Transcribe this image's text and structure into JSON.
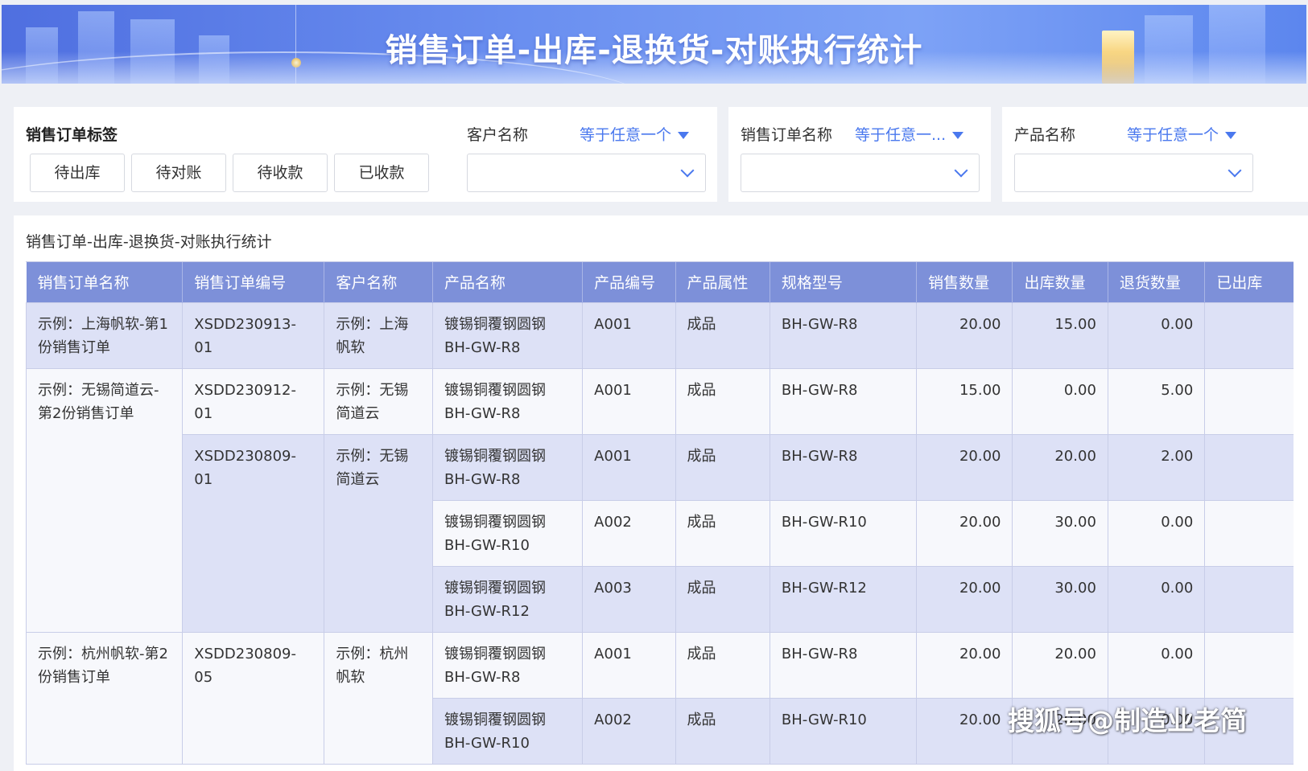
{
  "banner": {
    "title": "销售订单-出库-退换货-对账执行统计"
  },
  "tags": {
    "label": "销售订单标签",
    "buttons": [
      "待出库",
      "待对账",
      "待收款",
      "已收款"
    ]
  },
  "filters": [
    {
      "label": "客户名称",
      "operator": "等于任意一个"
    },
    {
      "label": "销售订单名称",
      "operator": "等于任意一..."
    },
    {
      "label": "产品名称",
      "operator": "等于任意一个"
    }
  ],
  "table": {
    "title": "销售订单-出库-退换货-对账执行统计",
    "headers": [
      "销售订单名称",
      "销售订单编号",
      "客户名称",
      "产品名称",
      "产品编号",
      "产品属性",
      "规格型号",
      "销售数量",
      "出库数量",
      "退货数量",
      "已出库"
    ],
    "rows": [
      {
        "order_name": "示例：上海帆软-第1份销售订单",
        "order_no": "XSDD230913-01",
        "customer": "示例：上海帆软",
        "product": "镀锡铜覆钢圆钢BH-GW-R8",
        "code": "A001",
        "attr": "成品",
        "spec": "BH-GW-R8",
        "sales": "20.00",
        "out": "15.00",
        "ret": "0.00"
      },
      {
        "order_name": "示例：无锡简道云-第2份销售订单",
        "order_no": "XSDD230912-01",
        "customer": "示例：无锡简道云",
        "product": "镀锡铜覆钢圆钢BH-GW-R8",
        "code": "A001",
        "attr": "成品",
        "spec": "BH-GW-R8",
        "sales": "15.00",
        "out": "0.00",
        "ret": "5.00"
      },
      {
        "order_no": "XSDD230809-01",
        "customer": "示例：无锡简道云",
        "product": "镀锡铜覆钢圆钢BH-GW-R8",
        "code": "A001",
        "attr": "成品",
        "spec": "BH-GW-R8",
        "sales": "20.00",
        "out": "20.00",
        "ret": "2.00"
      },
      {
        "product": "镀锡铜覆钢圆钢BH-GW-R10",
        "code": "A002",
        "attr": "成品",
        "spec": "BH-GW-R10",
        "sales": "20.00",
        "out": "30.00",
        "ret": "0.00"
      },
      {
        "product": "镀锡铜覆钢圆钢BH-GW-R12",
        "code": "A003",
        "attr": "成品",
        "spec": "BH-GW-R12",
        "sales": "20.00",
        "out": "30.00",
        "ret": "0.00"
      },
      {
        "order_name": "示例：杭州帆软-第2份销售订单",
        "order_no": "XSDD230809-05",
        "customer": "示例：杭州帆软",
        "product": "镀锡铜覆钢圆钢BH-GW-R8",
        "code": "A001",
        "attr": "成品",
        "spec": "BH-GW-R8",
        "sales": "20.00",
        "out": "20.00",
        "ret": "0.00"
      },
      {
        "product": "镀锡铜覆钢圆钢BH-GW-R10",
        "code": "A002",
        "attr": "成品",
        "spec": "BH-GW-R10",
        "sales": "20.00",
        "out": "20.00",
        "ret": "0.00"
      }
    ]
  },
  "watermark": "搜狐号@制造业老简"
}
